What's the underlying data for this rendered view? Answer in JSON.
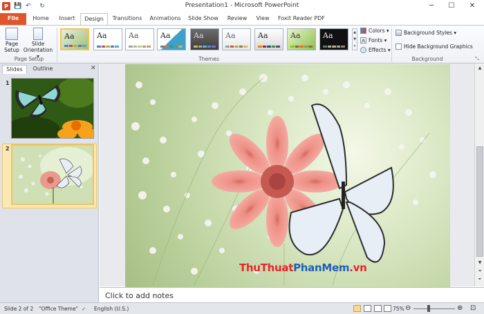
{
  "window": {
    "title": "Presentation1 - Microsoft PowerPoint",
    "logo_letter": "P",
    "qat": {
      "save": "💾",
      "undo": "↶",
      "redo": "↻"
    },
    "controls": {
      "minimize": "─",
      "maximize": "☐",
      "close": "✕"
    }
  },
  "tabs": [
    {
      "label": "File"
    },
    {
      "label": "Home"
    },
    {
      "label": "Insert"
    },
    {
      "label": "Design"
    },
    {
      "label": "Transitions"
    },
    {
      "label": "Animations"
    },
    {
      "label": "Slide Show"
    },
    {
      "label": "Review"
    },
    {
      "label": "View"
    },
    {
      "label": "Foxit Reader PDF"
    }
  ],
  "ribbon": {
    "page_setup": {
      "group_label": "Page Setup",
      "page_setup_label_1": "Page",
      "page_setup_label_2": "Setup",
      "orientation_label_1": "Slide",
      "orientation_label_2": "Orientation ▾"
    },
    "themes": {
      "group_label": "Themes",
      "sample_text": "Aa",
      "scroll_up": "▲",
      "scroll_down": "▼",
      "more": "▾"
    },
    "theme_options": {
      "colors": "Colors ▾",
      "fonts": "Fonts ▾",
      "effects": "Effects ▾"
    },
    "background": {
      "group_label": "Background",
      "styles": "Background Styles ▾",
      "hide_graphics": "Hide Background Graphics",
      "launcher": "⤡"
    }
  },
  "left_panel": {
    "tab_slides": "Slides",
    "tab_outline": "Outline",
    "close": "✕",
    "slides": [
      {
        "number": "1"
      },
      {
        "number": "2"
      }
    ]
  },
  "slide": {
    "watermark_part1": "ThuThuat",
    "watermark_part2": "PhanMem",
    "watermark_part3": ".vn"
  },
  "notes": {
    "placeholder": "Click to add notes"
  },
  "status": {
    "slide_info": "Slide 2 of 2",
    "theme": "\"Office Theme\"",
    "language": "English (U.S.)",
    "zoom": "75%",
    "zoom_minus": "⊖",
    "zoom_plus": "⊕"
  },
  "colors": {
    "file_tab": "#e0562a",
    "selection": "#f0c45c",
    "watermark_red": "#e8242b",
    "watermark_blue": "#1f5fb5"
  }
}
